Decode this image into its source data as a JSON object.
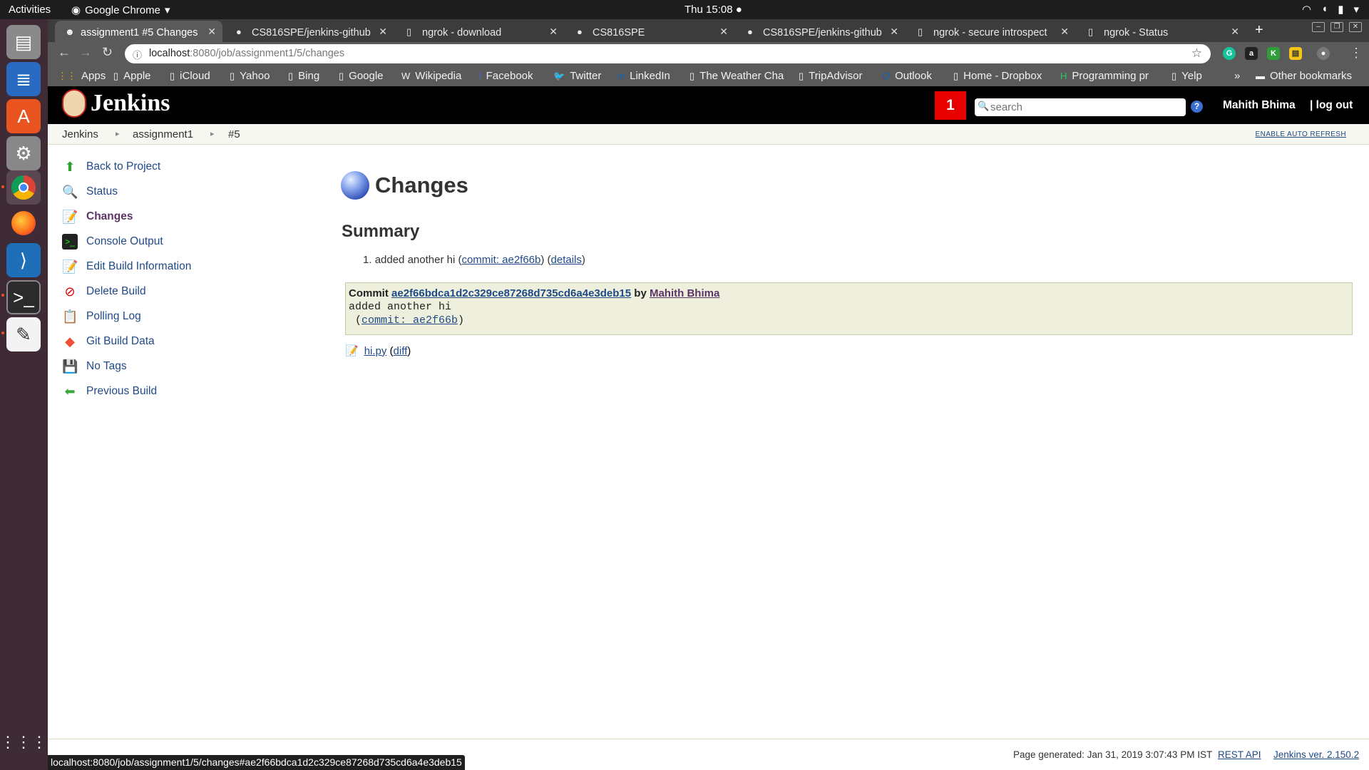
{
  "os": {
    "activities": "Activities",
    "app_name": "Google Chrome",
    "clock": "Thu 15:08 ●"
  },
  "browser": {
    "tabs": [
      {
        "title": "assignment1 #5 Changes"
      },
      {
        "title": "CS816SPE/jenkins-github"
      },
      {
        "title": "ngrok - download"
      },
      {
        "title": "CS816SPE"
      },
      {
        "title": "CS816SPE/jenkins-github"
      },
      {
        "title": "ngrok - secure introspect"
      },
      {
        "title": "ngrok - Status"
      }
    ],
    "url_host": "localhost",
    "url_rest": ":8080/job/assignment1/5/changes",
    "bookmarks": [
      "Apps",
      "Apple",
      "iCloud",
      "Yahoo",
      "Bing",
      "Google",
      "Wikipedia",
      "Facebook",
      "Twitter",
      "LinkedIn",
      "The Weather Cha",
      "TripAdvisor",
      "Outlook",
      "Home - Dropbox",
      "Programming pr",
      "Yelp"
    ],
    "overflow": "»",
    "other_bookmarks": "Other bookmarks",
    "status_url": "localhost:8080/job/assignment1/5/changes#ae2f66bdca1d2c329ce87268d735cd6a4e3deb15"
  },
  "jenkins": {
    "logo": "Jenkins",
    "notification_count": "1",
    "search_placeholder": "search",
    "user": "Mahith Bhima",
    "logout": "| log out",
    "breadcrumbs": [
      "Jenkins",
      "assignment1",
      "#5"
    ],
    "auto_refresh": "ENABLE AUTO REFRESH",
    "sidebar": [
      "Back to Project",
      "Status",
      "Changes",
      "Console Output",
      "Edit Build Information",
      "Delete Build",
      "Polling Log",
      "Git Build Data",
      "No Tags",
      "Previous Build"
    ],
    "title": "Changes",
    "summary_heading": "Summary",
    "summary_item": {
      "num": "1.",
      "msg": "added another hi",
      "commit": "commit: ae2f66b",
      "details": "details"
    },
    "commit": {
      "label": "Commit",
      "hash": "ae2f66bdca1d2c329ce87268d735cd6a4e3deb15",
      "by": "by",
      "author": "Mahith Bhima",
      "message": "added another hi",
      "short": "commit: ae2f66b"
    },
    "file": {
      "name": "hi.py",
      "diff": "diff"
    },
    "footer": {
      "generated": "Page generated: Jan 31, 2019 3:07:43 PM IST",
      "rest_api": "REST API",
      "version": "Jenkins ver. 2.150.2"
    }
  }
}
